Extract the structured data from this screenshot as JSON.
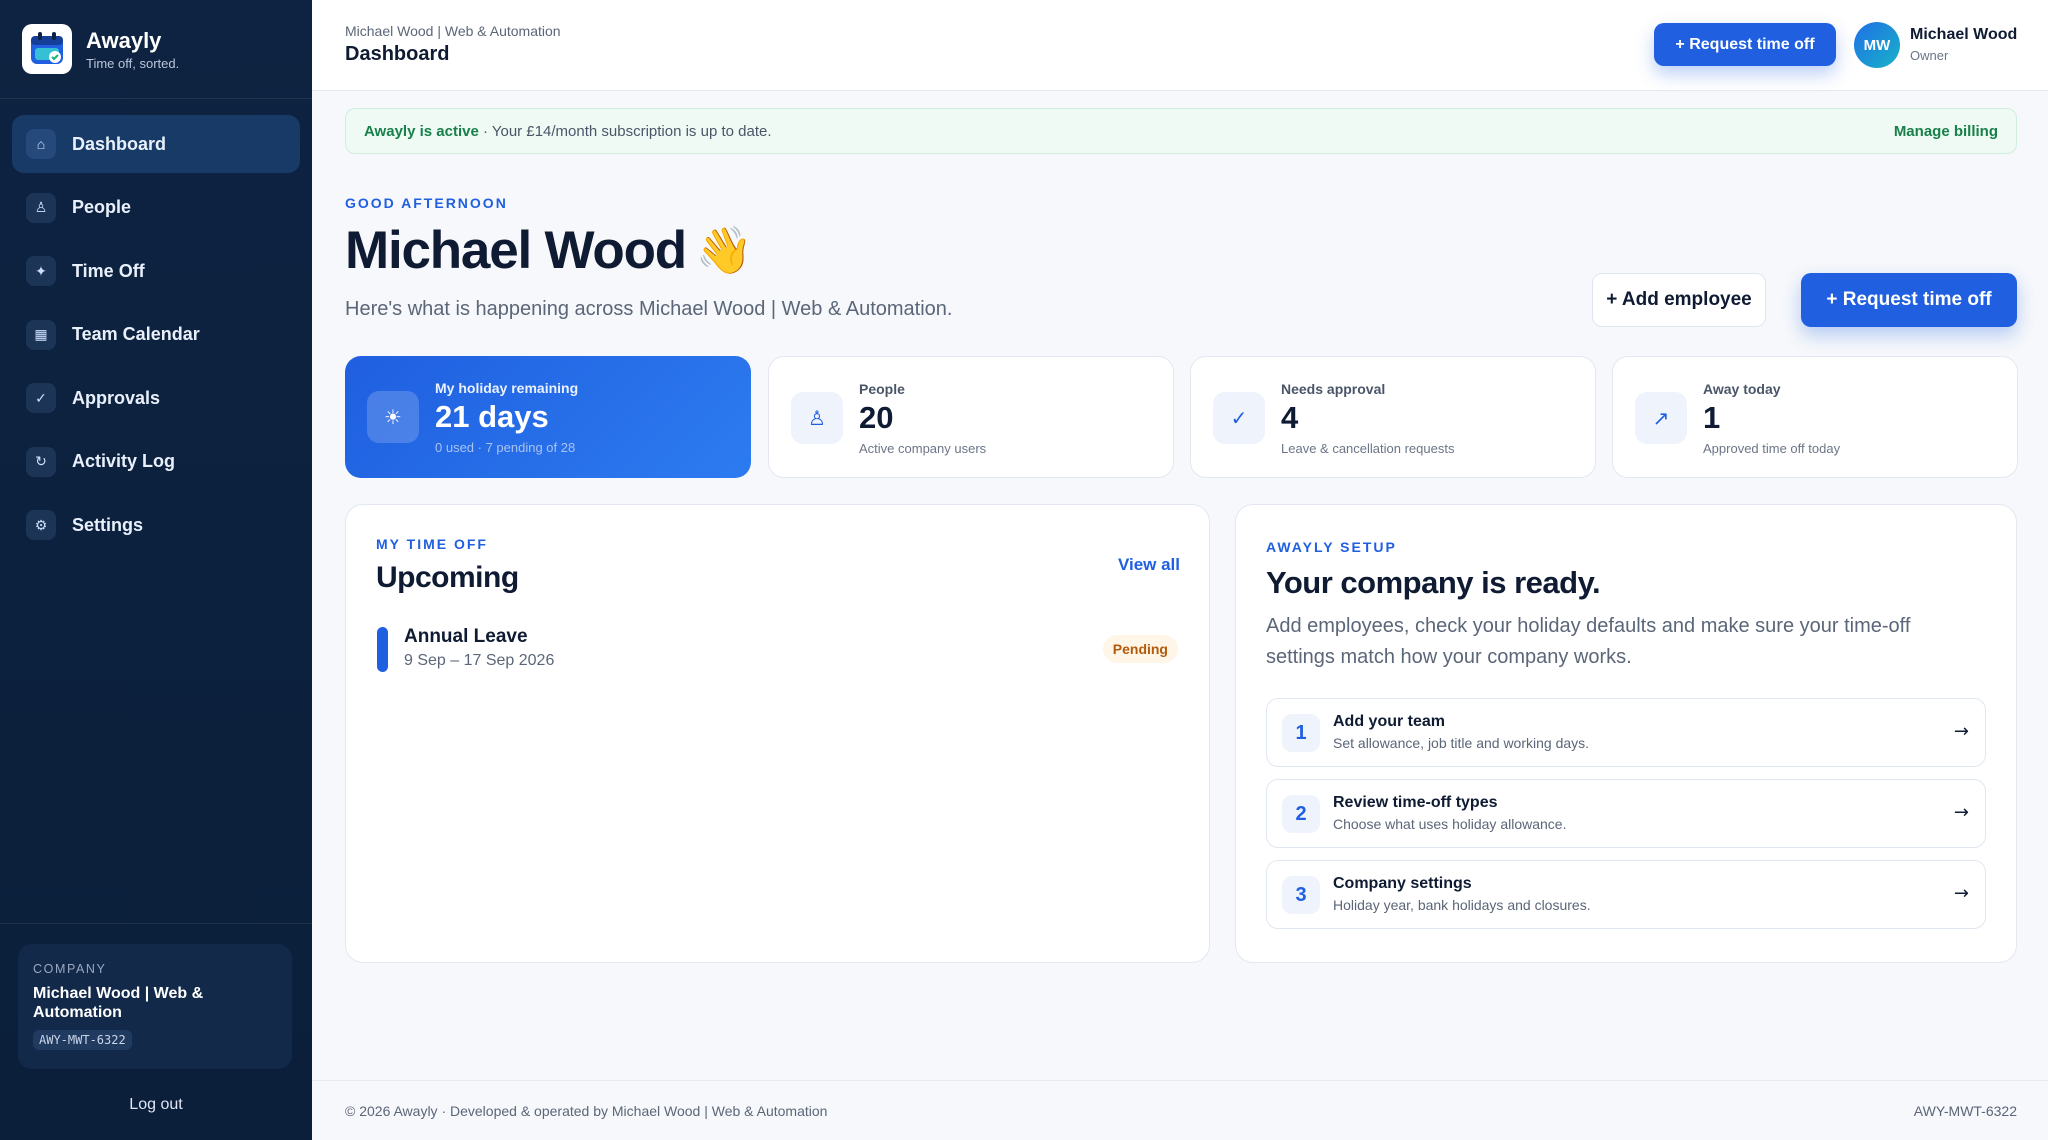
{
  "brand": {
    "name": "Awayly",
    "tagline": "Time off, sorted."
  },
  "sidebar": {
    "items": [
      {
        "label": "Dashboard",
        "icon": "home-icon",
        "glyph": "⌂",
        "active": true
      },
      {
        "label": "People",
        "icon": "person-icon",
        "glyph": "♙",
        "active": false
      },
      {
        "label": "Time Off",
        "icon": "sparkle-icon",
        "glyph": "✦",
        "active": false
      },
      {
        "label": "Team Calendar",
        "icon": "calendar-icon",
        "glyph": "▦",
        "active": false
      },
      {
        "label": "Approvals",
        "icon": "check-icon",
        "glyph": "✓",
        "active": false
      },
      {
        "label": "Activity Log",
        "icon": "refresh-icon",
        "glyph": "↻",
        "active": false
      },
      {
        "label": "Settings",
        "icon": "gear-icon",
        "glyph": "⚙",
        "active": false
      }
    ],
    "company_label": "COMPANY",
    "company_name": "Michael Wood | Web & Automation",
    "company_code": "AWY-MWT-6322",
    "logout": "Log out"
  },
  "topbar": {
    "breadcrumb": "Michael Wood | Web & Automation",
    "title": "Dashboard",
    "request_button": "+ Request time off",
    "avatar_initials": "MW",
    "user_name": "Michael Wood",
    "user_role": "Owner"
  },
  "banner": {
    "status": "Awayly is active",
    "text": " · Your £14/month subscription is up to date.",
    "link": "Manage billing"
  },
  "hero": {
    "greeting": "GOOD AFTERNOON",
    "name": "Michael Wood",
    "wave": "👋",
    "subtitle": "Here's what is happening across Michael Wood | Web & Automation.",
    "add_employee": "+ Add employee",
    "request_button": "+ Request time off"
  },
  "stats": [
    {
      "label": "My holiday remaining",
      "value": "21 days",
      "sub": "0 used · 7 pending of 28",
      "icon": "sun-icon",
      "glyph": "☀"
    },
    {
      "label": "People",
      "value": "20",
      "sub": "Active company users",
      "icon": "person-icon",
      "glyph": "♙"
    },
    {
      "label": "Needs approval",
      "value": "4",
      "sub": "Leave & cancellation requests",
      "icon": "check-icon",
      "glyph": "✓"
    },
    {
      "label": "Away today",
      "value": "1",
      "sub": "Approved time off today",
      "icon": "arrow-up-right-icon",
      "glyph": "↗"
    }
  ],
  "upcoming": {
    "eyebrow": "MY TIME OFF",
    "title": "Upcoming",
    "view_all": "View all",
    "items": [
      {
        "title": "Annual Leave",
        "dates": "9 Sep – 17 Sep 2026",
        "status": "Pending"
      }
    ]
  },
  "setup": {
    "eyebrow": "AWAYLY SETUP",
    "title": "Your company is ready.",
    "description": "Add employees, check your holiday defaults and make sure your time-off settings match how your company works.",
    "steps": [
      {
        "num": "1",
        "title": "Add your team",
        "sub": "Set allowance, job title and working days."
      },
      {
        "num": "2",
        "title": "Review time-off types",
        "sub": "Choose what uses holiday allowance."
      },
      {
        "num": "3",
        "title": "Company settings",
        "sub": "Holiday year, bank holidays and closures."
      }
    ]
  },
  "footer": {
    "left": "© 2026 Awayly · Developed & operated by Michael Wood | Web & Automation",
    "right": "AWY-MWT-6322"
  },
  "colors": {
    "accent": "#1f5fe0",
    "sidebar": "#0d2341",
    "success": "#18804a",
    "pending": "#b45a0a"
  }
}
